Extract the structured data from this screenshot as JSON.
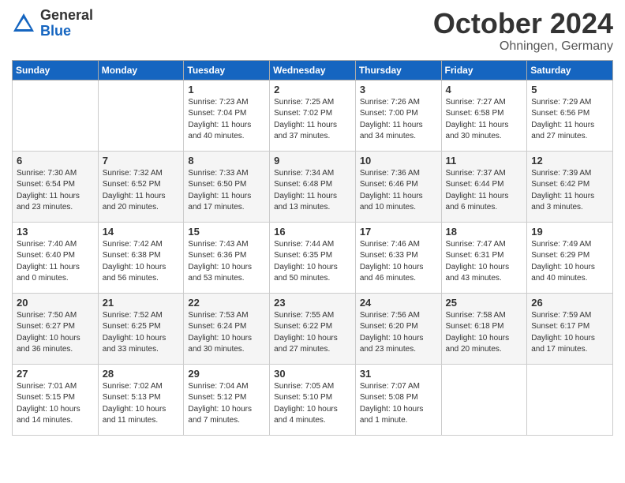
{
  "header": {
    "logo_general": "General",
    "logo_blue": "Blue",
    "month": "October 2024",
    "location": "Ohningen, Germany"
  },
  "days_of_week": [
    "Sunday",
    "Monday",
    "Tuesday",
    "Wednesday",
    "Thursday",
    "Friday",
    "Saturday"
  ],
  "weeks": [
    [
      {
        "day": "",
        "content": ""
      },
      {
        "day": "",
        "content": ""
      },
      {
        "day": "1",
        "content": "Sunrise: 7:23 AM\nSunset: 7:04 PM\nDaylight: 11 hours and 40 minutes."
      },
      {
        "day": "2",
        "content": "Sunrise: 7:25 AM\nSunset: 7:02 PM\nDaylight: 11 hours and 37 minutes."
      },
      {
        "day": "3",
        "content": "Sunrise: 7:26 AM\nSunset: 7:00 PM\nDaylight: 11 hours and 34 minutes."
      },
      {
        "day": "4",
        "content": "Sunrise: 7:27 AM\nSunset: 6:58 PM\nDaylight: 11 hours and 30 minutes."
      },
      {
        "day": "5",
        "content": "Sunrise: 7:29 AM\nSunset: 6:56 PM\nDaylight: 11 hours and 27 minutes."
      }
    ],
    [
      {
        "day": "6",
        "content": "Sunrise: 7:30 AM\nSunset: 6:54 PM\nDaylight: 11 hours and 23 minutes."
      },
      {
        "day": "7",
        "content": "Sunrise: 7:32 AM\nSunset: 6:52 PM\nDaylight: 11 hours and 20 minutes."
      },
      {
        "day": "8",
        "content": "Sunrise: 7:33 AM\nSunset: 6:50 PM\nDaylight: 11 hours and 17 minutes."
      },
      {
        "day": "9",
        "content": "Sunrise: 7:34 AM\nSunset: 6:48 PM\nDaylight: 11 hours and 13 minutes."
      },
      {
        "day": "10",
        "content": "Sunrise: 7:36 AM\nSunset: 6:46 PM\nDaylight: 11 hours and 10 minutes."
      },
      {
        "day": "11",
        "content": "Sunrise: 7:37 AM\nSunset: 6:44 PM\nDaylight: 11 hours and 6 minutes."
      },
      {
        "day": "12",
        "content": "Sunrise: 7:39 AM\nSunset: 6:42 PM\nDaylight: 11 hours and 3 minutes."
      }
    ],
    [
      {
        "day": "13",
        "content": "Sunrise: 7:40 AM\nSunset: 6:40 PM\nDaylight: 11 hours and 0 minutes."
      },
      {
        "day": "14",
        "content": "Sunrise: 7:42 AM\nSunset: 6:38 PM\nDaylight: 10 hours and 56 minutes."
      },
      {
        "day": "15",
        "content": "Sunrise: 7:43 AM\nSunset: 6:36 PM\nDaylight: 10 hours and 53 minutes."
      },
      {
        "day": "16",
        "content": "Sunrise: 7:44 AM\nSunset: 6:35 PM\nDaylight: 10 hours and 50 minutes."
      },
      {
        "day": "17",
        "content": "Sunrise: 7:46 AM\nSunset: 6:33 PM\nDaylight: 10 hours and 46 minutes."
      },
      {
        "day": "18",
        "content": "Sunrise: 7:47 AM\nSunset: 6:31 PM\nDaylight: 10 hours and 43 minutes."
      },
      {
        "day": "19",
        "content": "Sunrise: 7:49 AM\nSunset: 6:29 PM\nDaylight: 10 hours and 40 minutes."
      }
    ],
    [
      {
        "day": "20",
        "content": "Sunrise: 7:50 AM\nSunset: 6:27 PM\nDaylight: 10 hours and 36 minutes."
      },
      {
        "day": "21",
        "content": "Sunrise: 7:52 AM\nSunset: 6:25 PM\nDaylight: 10 hours and 33 minutes."
      },
      {
        "day": "22",
        "content": "Sunrise: 7:53 AM\nSunset: 6:24 PM\nDaylight: 10 hours and 30 minutes."
      },
      {
        "day": "23",
        "content": "Sunrise: 7:55 AM\nSunset: 6:22 PM\nDaylight: 10 hours and 27 minutes."
      },
      {
        "day": "24",
        "content": "Sunrise: 7:56 AM\nSunset: 6:20 PM\nDaylight: 10 hours and 23 minutes."
      },
      {
        "day": "25",
        "content": "Sunrise: 7:58 AM\nSunset: 6:18 PM\nDaylight: 10 hours and 20 minutes."
      },
      {
        "day": "26",
        "content": "Sunrise: 7:59 AM\nSunset: 6:17 PM\nDaylight: 10 hours and 17 minutes."
      }
    ],
    [
      {
        "day": "27",
        "content": "Sunrise: 7:01 AM\nSunset: 5:15 PM\nDaylight: 10 hours and 14 minutes."
      },
      {
        "day": "28",
        "content": "Sunrise: 7:02 AM\nSunset: 5:13 PM\nDaylight: 10 hours and 11 minutes."
      },
      {
        "day": "29",
        "content": "Sunrise: 7:04 AM\nSunset: 5:12 PM\nDaylight: 10 hours and 7 minutes."
      },
      {
        "day": "30",
        "content": "Sunrise: 7:05 AM\nSunset: 5:10 PM\nDaylight: 10 hours and 4 minutes."
      },
      {
        "day": "31",
        "content": "Sunrise: 7:07 AM\nSunset: 5:08 PM\nDaylight: 10 hours and 1 minute."
      },
      {
        "day": "",
        "content": ""
      },
      {
        "day": "",
        "content": ""
      }
    ]
  ]
}
